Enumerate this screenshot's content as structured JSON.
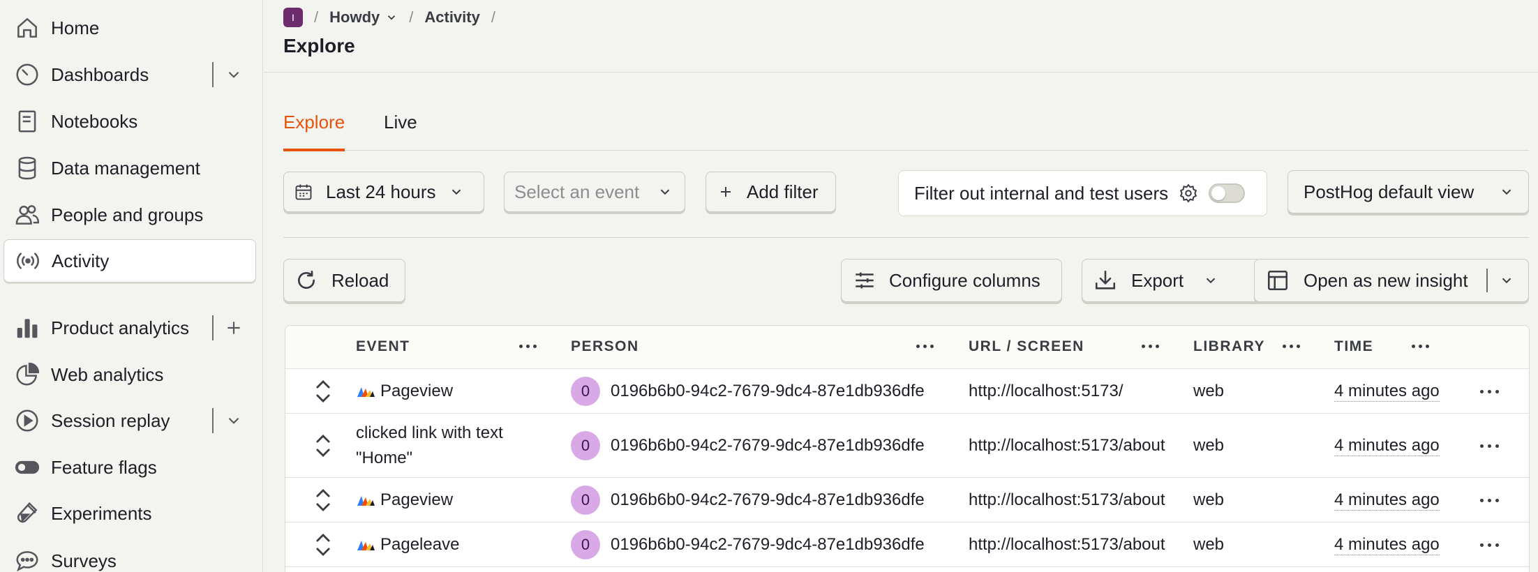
{
  "sidebar": {
    "items": [
      {
        "label": "Home",
        "icon": "home-icon"
      },
      {
        "label": "Dashboards",
        "icon": "dashboard-gauge-icon"
      },
      {
        "label": "Notebooks",
        "icon": "notebook-icon"
      },
      {
        "label": "Data management",
        "icon": "database-icon"
      },
      {
        "label": "People and groups",
        "icon": "people-icon"
      },
      {
        "label": "Activity",
        "icon": "broadcast-icon",
        "active": true
      },
      {
        "label": "Product analytics",
        "icon": "bar-chart-icon"
      },
      {
        "label": "Web analytics",
        "icon": "pie-chart-icon"
      },
      {
        "label": "Session replay",
        "icon": "replay-icon"
      },
      {
        "label": "Feature flags",
        "icon": "toggle-icon"
      },
      {
        "label": "Experiments",
        "icon": "flask-icon"
      },
      {
        "label": "Surveys",
        "icon": "chat-bubble-icon"
      }
    ]
  },
  "header": {
    "org_initial": "I",
    "project": "Howdy",
    "section": "Activity",
    "title": "Explore"
  },
  "tabs": [
    {
      "label": "Explore",
      "active": true
    },
    {
      "label": "Live",
      "active": false
    }
  ],
  "filters": {
    "date_range": "Last 24 hours",
    "event_placeholder": "Select an event",
    "add_filter": "Add filter",
    "internal_users": "Filter out internal and test users",
    "internal_users_enabled": false,
    "view": "PostHog default view"
  },
  "toolbar": {
    "reload": "Reload",
    "configure_columns": "Configure columns",
    "export": "Export",
    "open_insight": "Open as new insight"
  },
  "table": {
    "columns": [
      "EVENT",
      "PERSON",
      "URL / SCREEN",
      "LIBRARY",
      "TIME"
    ],
    "rows": [
      {
        "event": "Pageview",
        "event_icon": "pageview-icon",
        "person_initial": "0",
        "person": "0196b6b0-94c2-7679-9dc4-87e1db936dfe",
        "url": "http://localhost:5173/",
        "library": "web",
        "time": "4 minutes ago"
      },
      {
        "event": "clicked link with text \"Home\"",
        "event_icon": "",
        "person_initial": "0",
        "person": "0196b6b0-94c2-7679-9dc4-87e1db936dfe",
        "url": "http://localhost:5173/about",
        "library": "web",
        "time": "4 minutes ago"
      },
      {
        "event": "Pageview",
        "event_icon": "pageview-icon",
        "person_initial": "0",
        "person": "0196b6b0-94c2-7679-9dc4-87e1db936dfe",
        "url": "http://localhost:5173/about",
        "library": "web",
        "time": "4 minutes ago"
      },
      {
        "event": "Pageleave",
        "event_icon": "pageleave-icon",
        "person_initial": "0",
        "person": "0196b6b0-94c2-7679-9dc4-87e1db936dfe",
        "url": "http://localhost:5173/about",
        "library": "web",
        "time": "4 minutes ago"
      }
    ]
  },
  "colors": {
    "accent": "#e8530b",
    "background": "#f3f4ef",
    "avatar": "#d8a9e6",
    "org_badge": "#6c2c6d"
  }
}
